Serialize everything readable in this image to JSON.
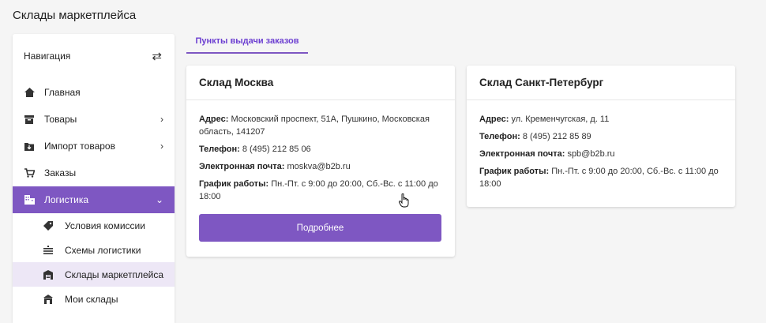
{
  "page": {
    "title": "Склады маркетплейса"
  },
  "sidebar": {
    "header": "Навигация",
    "items": [
      {
        "label": "Главная",
        "icon": "home-icon"
      },
      {
        "label": "Товары",
        "icon": "box-icon",
        "has_children": true
      },
      {
        "label": "Импорт товаров",
        "icon": "import-icon",
        "has_children": true
      },
      {
        "label": "Заказы",
        "icon": "cart-icon"
      },
      {
        "label": "Логистика",
        "icon": "building-icon",
        "has_children": true,
        "expanded": true,
        "active": true
      }
    ],
    "sub_items": [
      {
        "label": "Условия комиссии",
        "icon": "tag-icon"
      },
      {
        "label": "Схемы логистики",
        "icon": "list-icon"
      },
      {
        "label": "Склады маркетплейса",
        "icon": "warehouse-icon",
        "selected": true
      },
      {
        "label": "Мои склады",
        "icon": "store-icon"
      }
    ]
  },
  "tabs": [
    {
      "label": "Пункты выдачи заказов",
      "active": true
    }
  ],
  "cards": [
    {
      "title": "Склад Москва",
      "address_label": "Адрес:",
      "address": "Московский проспект, 51А, Пушкино, Московская область, 141207",
      "phone_label": "Телефон:",
      "phone": "8 (495) 212 85 06",
      "email_label": "Электронная почта:",
      "email": "moskva@b2b.ru",
      "hours_label": "График работы:",
      "hours": "Пн.-Пт. с 9:00 до 20:00, Сб.-Вс. с 11:00 до 18:00",
      "button_label": "Подробнее"
    },
    {
      "title": "Склад Санкт-Петербург",
      "address_label": "Адрес:",
      "address": "ул. Кременчугская, д. 11",
      "phone_label": "Телефон:",
      "phone": "8 (495) 212 85 89",
      "email_label": "Электронная почта:",
      "email": "spb@b2b.ru",
      "hours_label": "График работы:",
      "hours": "Пн.-Пт. с 9:00 до 20:00, Сб.-Вс. с 11:00 до 18:00"
    }
  ],
  "colors": {
    "accent": "#7e57c2",
    "accent_light": "#ede7f6",
    "tab_text": "#6c3fd1"
  }
}
